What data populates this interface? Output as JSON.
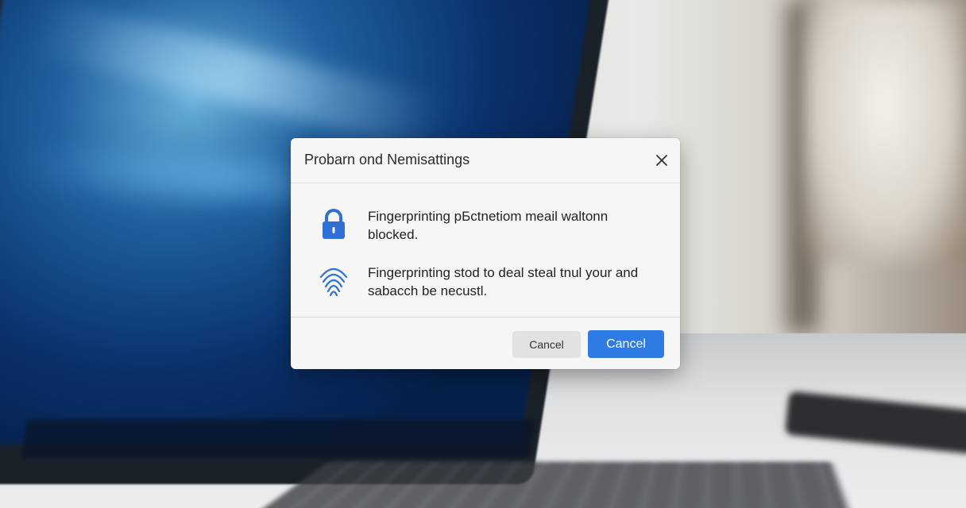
{
  "dialog": {
    "title": "Probarn ond Nemisattings",
    "close_icon": "close-icon",
    "items": [
      {
        "icon": "lock-icon",
        "text": "Fingerprinting pБctnetiom meail waltonn blocked."
      },
      {
        "icon": "fingerprint-icon",
        "text": "Fingerprinting stod to deal steal tnul your and sabacch be necustl."
      }
    ],
    "buttons": {
      "secondary_label": "Cancel",
      "primary_label": "Cancel"
    }
  },
  "colors": {
    "accent": "#2f7be4",
    "dialog_bg": "#f6f6f6",
    "secondary_button": "#e2e2e2"
  }
}
